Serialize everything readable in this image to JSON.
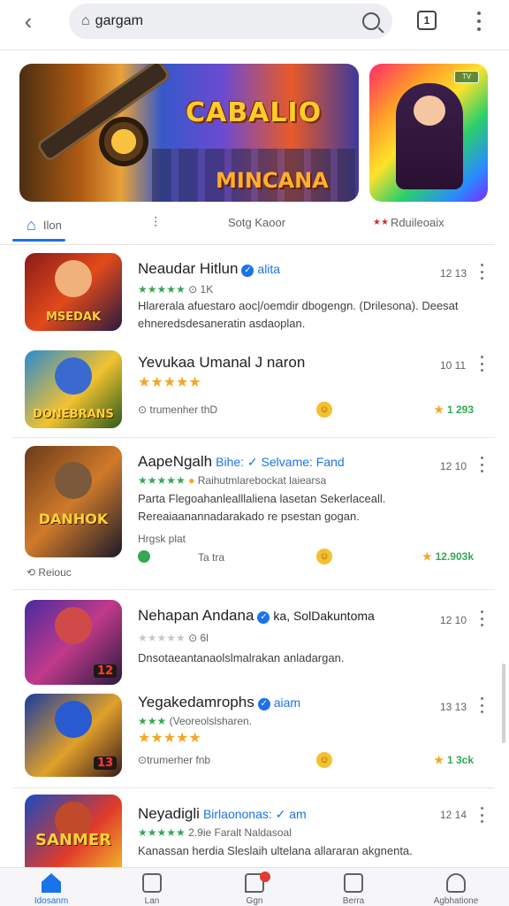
{
  "search": {
    "query": "gargam"
  },
  "topbar": {
    "tabs_count": "1"
  },
  "banner": {
    "title": "CABALIO",
    "subtitle": "MINCANA",
    "side_badge": "TV"
  },
  "categories": [
    {
      "label": "Ilon"
    },
    {
      "label": ""
    },
    {
      "label": "Sotg Kaoor"
    },
    {
      "label": "Rduileoaix"
    }
  ],
  "apps": [
    {
      "name": "Neaudar Hitlun",
      "tag": "alita",
      "rating_count": "1K",
      "time": "12 13",
      "thumb_label": "MSEDAK",
      "desc": "Hlarerala afuestaro aoc|/oemdir dbogengn. (Drilesona). Deesat ehneredsdesaneratin asdaoplan."
    },
    {
      "name": "Yevukaa Umanal J naron",
      "time": "10 11",
      "thumb_label": "DONEBRANS",
      "footer_left": "trumenher thD",
      "footer_right": "1 293"
    },
    {
      "name": "AapeNgalh",
      "tag": "Bihe: ✓ Selvame: Fand",
      "rating_text": "Raihutmlarebockat laiearsa",
      "time": "12 10",
      "thumb_label": "DANHOK",
      "desc": "Parta Flegoahanlealllaliena lasetan Sekerlaceall. Rereaiaanannadarakado re psestan gogan.",
      "sub_label": "Hrgsk plat",
      "footer_left": "Ta tra",
      "footer_right": "12.903k"
    },
    {
      "name": "Nehapan Andana",
      "tag": "ka, SolDakuntoma",
      "rating_count": "6l",
      "time": "12 10",
      "thumb_label": "12",
      "desc": "Dnsotaeantanaolslmalrakan anladargan."
    },
    {
      "name": "Yegakedamrophs",
      "tag": "aiam",
      "rating_text": "(Veoreolslsharen.",
      "time": "13 13",
      "thumb_label": "13",
      "footer_left": "trumerher fnb",
      "footer_right": "1 3ck"
    },
    {
      "name": "Neyadigli",
      "tag": "Birlaononas: ✓ am",
      "rating_text": "2.9ie Faralt  Naldasoal",
      "time": "12 14",
      "thumb_label": "SANMER",
      "desc": "Kanassan herdia Sleslaih ultelana allararan akgnenta."
    }
  ],
  "rescuer_label": "Reiouc",
  "bottomnav": [
    {
      "label": "Idosanm"
    },
    {
      "label": "Lan"
    },
    {
      "label": "Ggn"
    },
    {
      "label": "Berra"
    },
    {
      "label": "Agbhatione"
    }
  ]
}
